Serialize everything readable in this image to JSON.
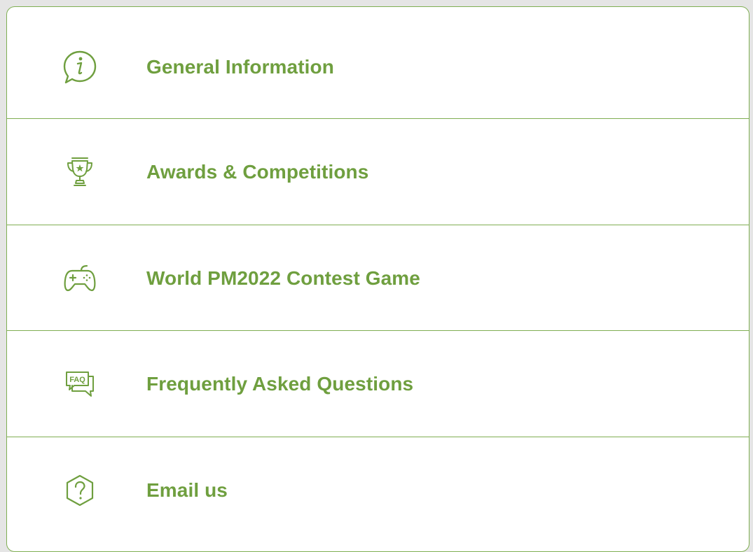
{
  "menu": {
    "items": [
      {
        "label": "General Information",
        "icon": "info-speech-bubble-icon"
      },
      {
        "label": "Awards & Competitions",
        "icon": "trophy-icon"
      },
      {
        "label": "World PM2022 Contest Game",
        "icon": "gamepad-icon"
      },
      {
        "label": "Frequently Asked Questions",
        "icon": "faq-bubble-icon"
      },
      {
        "label": "Email us",
        "icon": "question-hexagon-icon"
      }
    ],
    "faq_icon_text": "FAQ"
  },
  "colors": {
    "accent": "#6f9f3f",
    "border": "#7fae52",
    "background": "#e5e5e5",
    "panel": "#ffffff"
  }
}
